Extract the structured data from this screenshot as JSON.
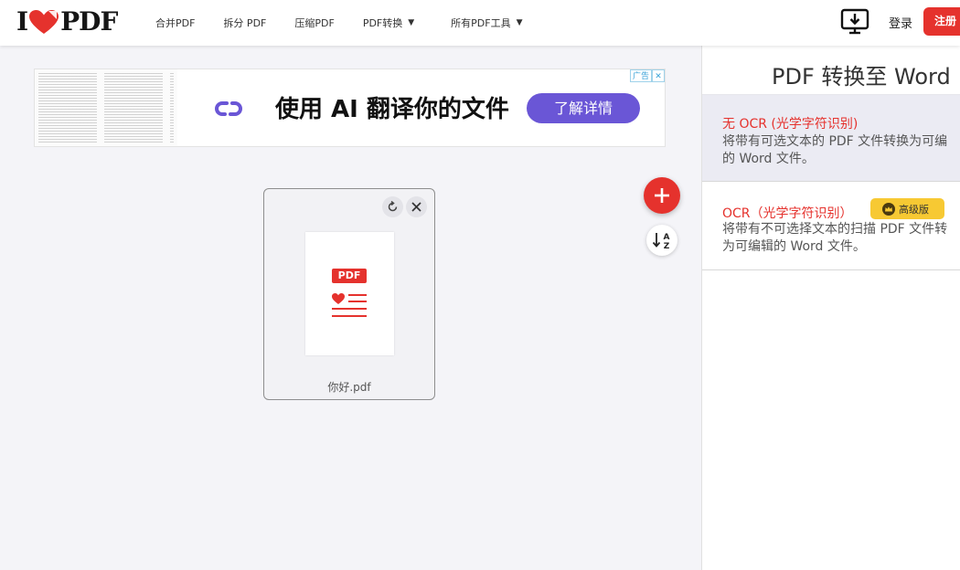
{
  "header": {
    "logo_left": "I",
    "logo_right": "PDF",
    "nav": [
      {
        "label": "合并PDF",
        "has_caret": false
      },
      {
        "label": "拆分 PDF",
        "has_caret": false
      },
      {
        "label": "压缩PDF",
        "has_caret": false
      },
      {
        "label": "PDF转换",
        "has_caret": true
      },
      {
        "label": "所有PDF工具",
        "has_caret": true
      }
    ],
    "caret_glyph": "▼",
    "download_icon": "desktop-download-icon",
    "login_label": "登录",
    "register_label": "注册"
  },
  "ad": {
    "headline": "使用 AI 翻译你的文件",
    "cta_label": "了解详情",
    "badge_label": "广告",
    "badge_close": "✕",
    "logo_icon": "link-logo-icon",
    "brand_color": "#6a56d6"
  },
  "file": {
    "name": "你好.pdf",
    "badge_text": "PDF",
    "rotate_icon": "rotate-icon",
    "remove_icon": "close-icon"
  },
  "actions": {
    "add_icon": "plus-icon",
    "sort_icon": "sort-az-icon",
    "accent": "#e5322d"
  },
  "panel": {
    "title": "PDF 转换至 Word",
    "options": [
      {
        "title": "无 OCR (光学字符识别)",
        "desc_line1": "将带有可选文本的 PDF 文件转换为可编",
        "desc_line2": "的 Word 文件。",
        "selected": true
      },
      {
        "title": "OCR（光学字符识别）",
        "desc_line1": "将带有不可选择文本的扫描 PDF 文件转",
        "desc_line2": "为可编辑的 Word 文件。",
        "selected": false,
        "badge": "高级版"
      }
    ]
  }
}
